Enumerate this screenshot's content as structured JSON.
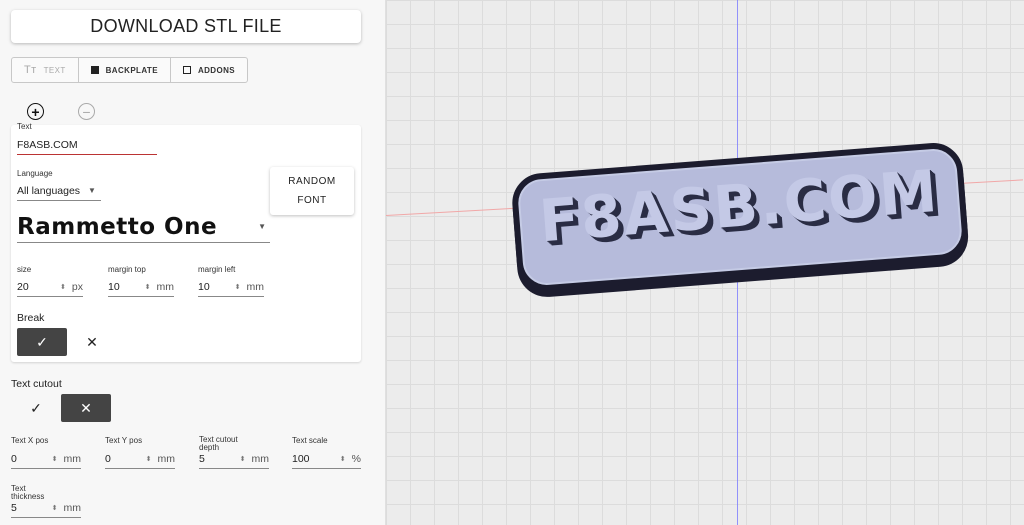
{
  "download": {
    "label": "DOWNLOAD STL FILE"
  },
  "tabs": [
    {
      "label": "TEXT",
      "icon": "text-format-icon",
      "disabled": true
    },
    {
      "label": "BACKPLATE",
      "icon": "filled-square-icon"
    },
    {
      "label": "ADDONS",
      "icon": "empty-square-icon"
    }
  ],
  "line_controls": {
    "add_symbol": "+",
    "remove_symbol": "−"
  },
  "text_card": {
    "text_label": "Text",
    "text_value": "F8ASB.COM",
    "language_label": "Language",
    "language_value": "All languages",
    "font_value": "Rammetto One",
    "random_font_line1": "RANDOM",
    "random_font_line2": "FONT",
    "size_label": "size",
    "size_value": "20",
    "size_unit": "px",
    "margin_top_label": "margin top",
    "margin_top_value": "10",
    "margin_top_unit": "mm",
    "margin_left_label": "margin left",
    "margin_left_value": "10",
    "margin_left_unit": "mm",
    "break_label": "Break",
    "break_selected": "yes"
  },
  "cutout": {
    "label": "Text cutout",
    "selected": "no",
    "x_pos_label": "Text X pos",
    "x_pos_value": "0",
    "x_pos_unit": "mm",
    "y_pos_label": "Text Y pos",
    "y_pos_value": "0",
    "y_pos_unit": "mm",
    "depth_label_1": "Text cutout",
    "depth_label_2": "depth",
    "depth_value": "5",
    "depth_unit": "mm",
    "scale_label": "Text scale",
    "scale_value": "100",
    "scale_unit": "%",
    "thickness_label_1": "Text",
    "thickness_label_2": "thickness",
    "thickness_value": "5",
    "thickness_unit": "mm"
  },
  "preview": {
    "plate_text": "F8ASB.COM",
    "plate_color": "#c5cbe5",
    "outline_color": "#1c1c2e"
  },
  "icons": {
    "check": "✓",
    "cross": "✕",
    "spin": "⬍"
  }
}
